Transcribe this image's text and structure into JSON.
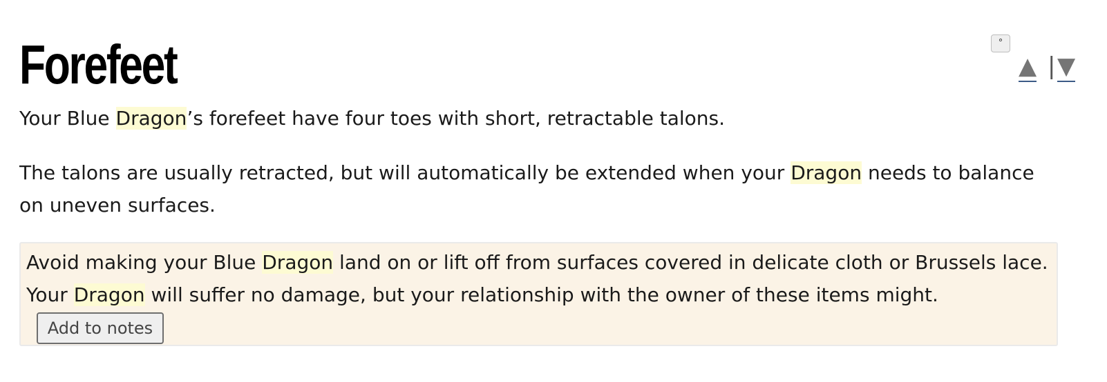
{
  "section": {
    "title": "Forefeet"
  },
  "controls": {
    "toggle_label": "°",
    "up_arrow": "▲",
    "separator": "|",
    "down_arrow": "▼"
  },
  "paragraphs": {
    "p1": {
      "before": "Your Blue ",
      "highlight": "Dragon",
      "after": "’s forefeet have four toes with short, retractable talons."
    },
    "p2": {
      "before": "The talons are usually retracted, but will automatically be extended when your ",
      "highlight": "Dragon",
      "after": " needs to balance on uneven surfaces."
    }
  },
  "callout": {
    "part1": "Avoid making your Blue ",
    "highlight1": "Dragon",
    "part2": " land on or lift off from surfaces covered in delicate cloth or Brussels lace. Your ",
    "highlight2": "Dragon",
    "part3": " will suffer no damage, but your relationship with the owner of these items might.",
    "button_label": "Add to notes"
  },
  "colors": {
    "highlight": "#fdfbd3",
    "callout_background": "#fbf3e6",
    "link_underline": "#3b5a86"
  }
}
